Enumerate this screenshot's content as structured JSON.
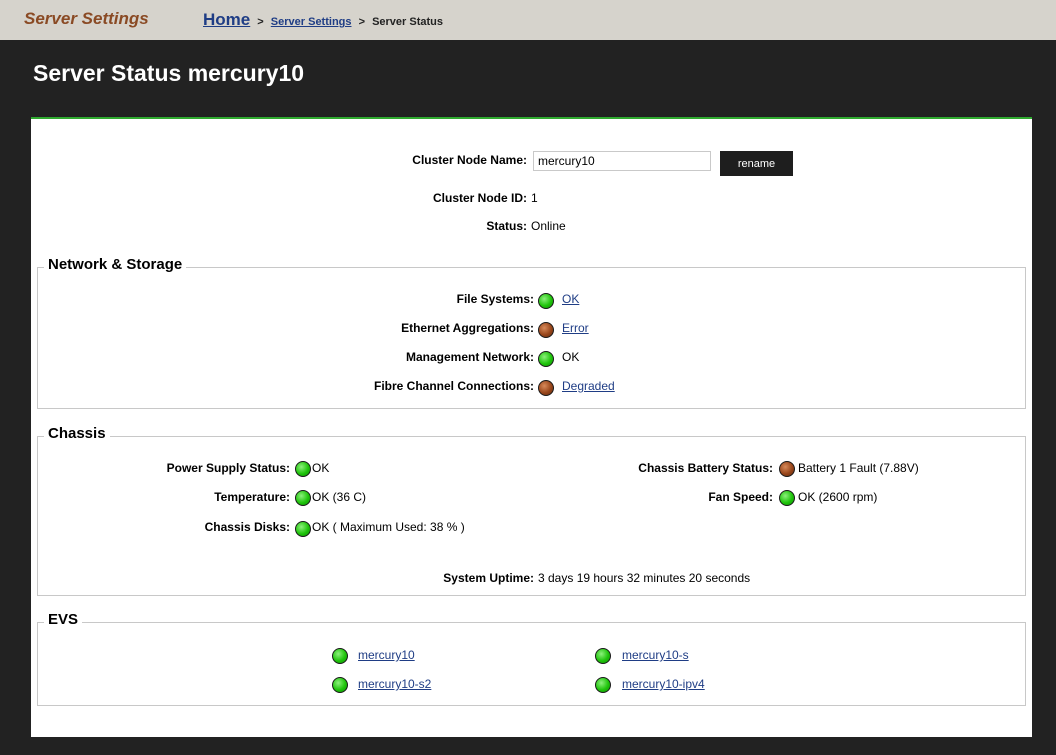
{
  "header": {
    "brand": "Server Settings",
    "breadcrumb": {
      "home": "Home",
      "sep": ">",
      "parent": "Server Settings",
      "current": "Server Status"
    }
  },
  "page": {
    "title": "Server Status mercury10"
  },
  "node": {
    "name_label": "Cluster Node Name:",
    "name_value": "mercury10",
    "rename_label": "rename",
    "id_label": "Cluster Node ID:",
    "id_value": "1",
    "status_label": "Status:",
    "status_value": "Online"
  },
  "network": {
    "title": "Network & Storage",
    "items": [
      {
        "label": "File Systems:",
        "value": "OK",
        "state": "ok",
        "link": true
      },
      {
        "label": "Ethernet Aggregations:",
        "value": "Error",
        "state": "error",
        "link": true
      },
      {
        "label": "Management Network:",
        "value": "OK",
        "state": "ok",
        "link": false
      },
      {
        "label": "Fibre Channel Connections:",
        "value": "Degraded",
        "state": "error",
        "link": true
      }
    ]
  },
  "chassis": {
    "title": "Chassis",
    "power_label": "Power Supply Status:",
    "power_value": "OK",
    "power_state": "ok",
    "temp_label": "Temperature:",
    "temp_value": "OK (36 C)",
    "temp_state": "ok",
    "disks_label": "Chassis Disks:",
    "disks_value": "OK ( Maximum Used: 38 % )",
    "disks_state": "ok",
    "battery_label": "Chassis Battery Status:",
    "battery_value": "Battery 1 Fault (7.88V)",
    "battery_state": "error",
    "fan_label": "Fan Speed:",
    "fan_value": "OK (2600 rpm)",
    "fan_state": "ok",
    "uptime_label": "System Uptime:",
    "uptime_value": "3 days 19 hours 32 minutes 20 seconds"
  },
  "evs": {
    "title": "EVS",
    "items": [
      {
        "name": "mercury10",
        "state": "ok"
      },
      {
        "name": "mercury10-s",
        "state": "ok"
      },
      {
        "name": "mercury10-s2",
        "state": "ok"
      },
      {
        "name": "mercury10-ipv4",
        "state": "ok"
      }
    ]
  },
  "colors": {
    "ok": "#1fc40b",
    "error": "#98461b",
    "accent": "#2faa2f",
    "link": "#1f3d85",
    "brand": "#8a4a24"
  }
}
